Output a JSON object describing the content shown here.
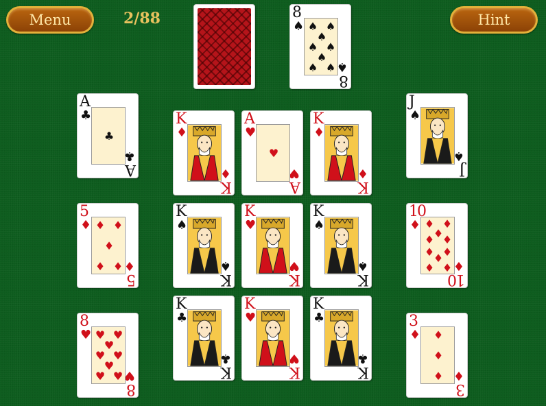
{
  "toolbar": {
    "menu_label": "Menu",
    "hint_label": "Hint",
    "counter": "2/88"
  },
  "colors": {
    "felt": "#0d5c1e",
    "button_gold": "#e3b13a",
    "button_brown": "#9a4f0a",
    "counter_text": "#e8c25e",
    "red_suit": "#d0101a"
  },
  "stock": {
    "face_down": true
  },
  "waste": {
    "rank": "8",
    "suit": "♠",
    "color": "black"
  },
  "tableau": [
    {
      "rank": "A",
      "suit": "♣",
      "color": "black"
    },
    {
      "rank": "K",
      "suit": "♦",
      "color": "red"
    },
    {
      "rank": "A",
      "suit": "♥",
      "color": "red"
    },
    {
      "rank": "K",
      "suit": "♦",
      "color": "red"
    },
    {
      "rank": "J",
      "suit": "♠",
      "color": "black"
    },
    {
      "rank": "5",
      "suit": "♦",
      "color": "red"
    },
    {
      "rank": "K",
      "suit": "♠",
      "color": "black"
    },
    {
      "rank": "K",
      "suit": "♥",
      "color": "red"
    },
    {
      "rank": "K",
      "suit": "♠",
      "color": "black"
    },
    {
      "rank": "10",
      "suit": "♦",
      "color": "red"
    },
    {
      "rank": "8",
      "suit": "♥",
      "color": "red"
    },
    {
      "rank": "K",
      "suit": "♣",
      "color": "black"
    },
    {
      "rank": "K",
      "suit": "♥",
      "color": "red"
    },
    {
      "rank": "K",
      "suit": "♣",
      "color": "black"
    },
    {
      "rank": "3",
      "suit": "♦",
      "color": "red"
    }
  ]
}
